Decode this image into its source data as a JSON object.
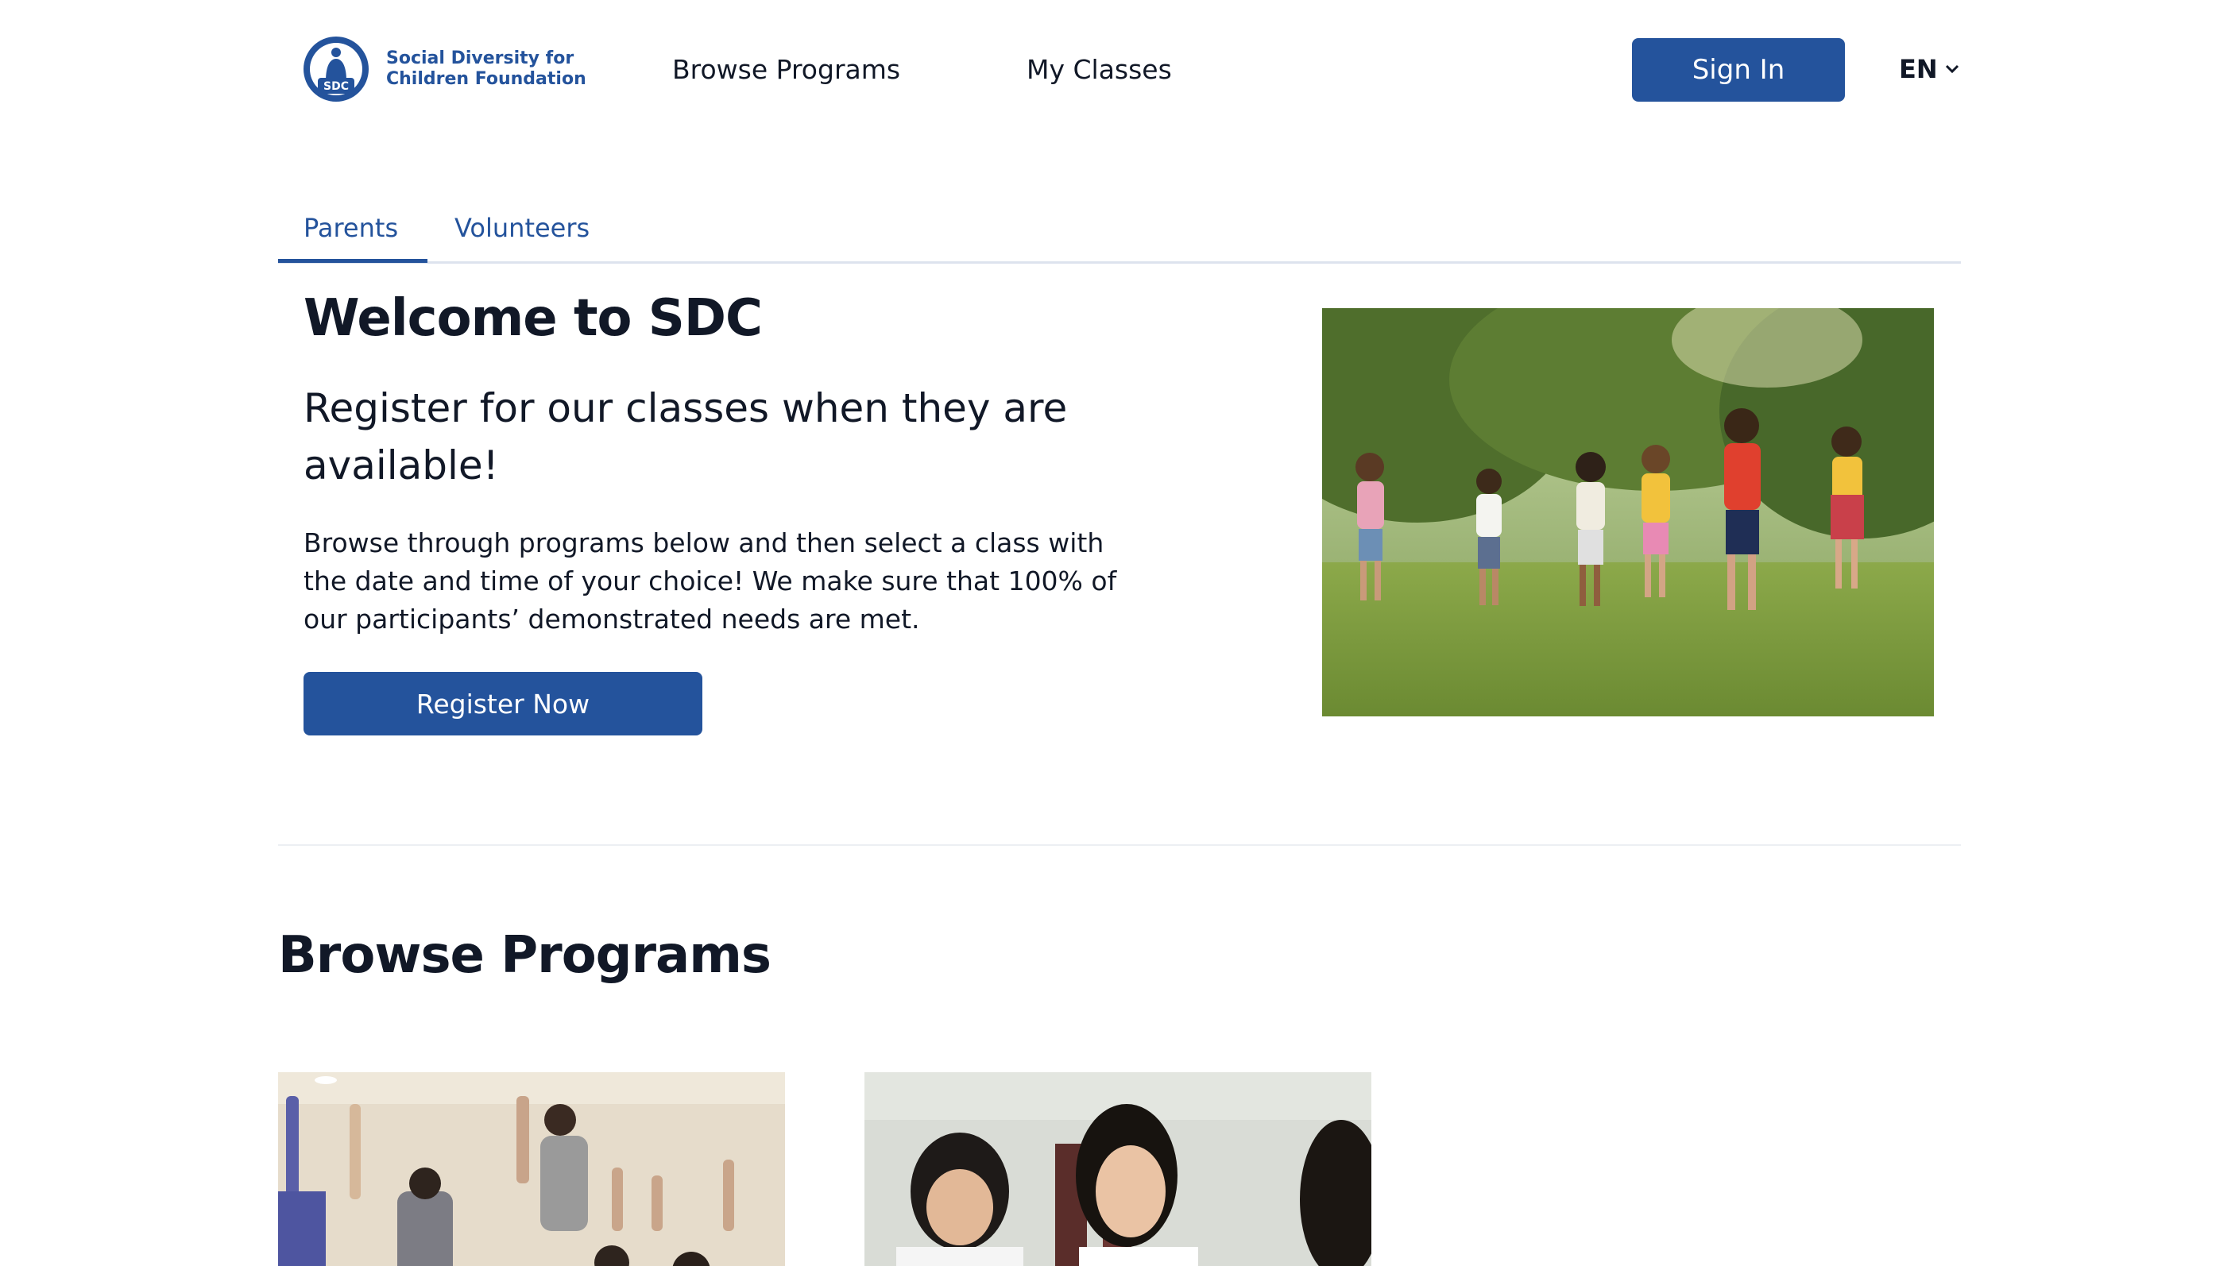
{
  "header": {
    "logo_line1": "Social Diversity for",
    "logo_line2": "Children Foundation",
    "logo_badge": "SDC",
    "nav": [
      "Browse Programs",
      "My Classes"
    ],
    "sign_in": "Sign In",
    "language": "EN"
  },
  "tabs": [
    "Parents",
    "Volunteers"
  ],
  "hero": {
    "title": "Welcome to SDC",
    "subtitle": "Register for our classes when they are available!",
    "body": "Browse through programs below and then select a class with the date and time of your choice! We make sure that 100% of our participants’ demonstrated needs are met.",
    "register": "Register Now"
  },
  "programs": {
    "title": "Browse Programs"
  },
  "colors": {
    "brand": "#24539c"
  }
}
